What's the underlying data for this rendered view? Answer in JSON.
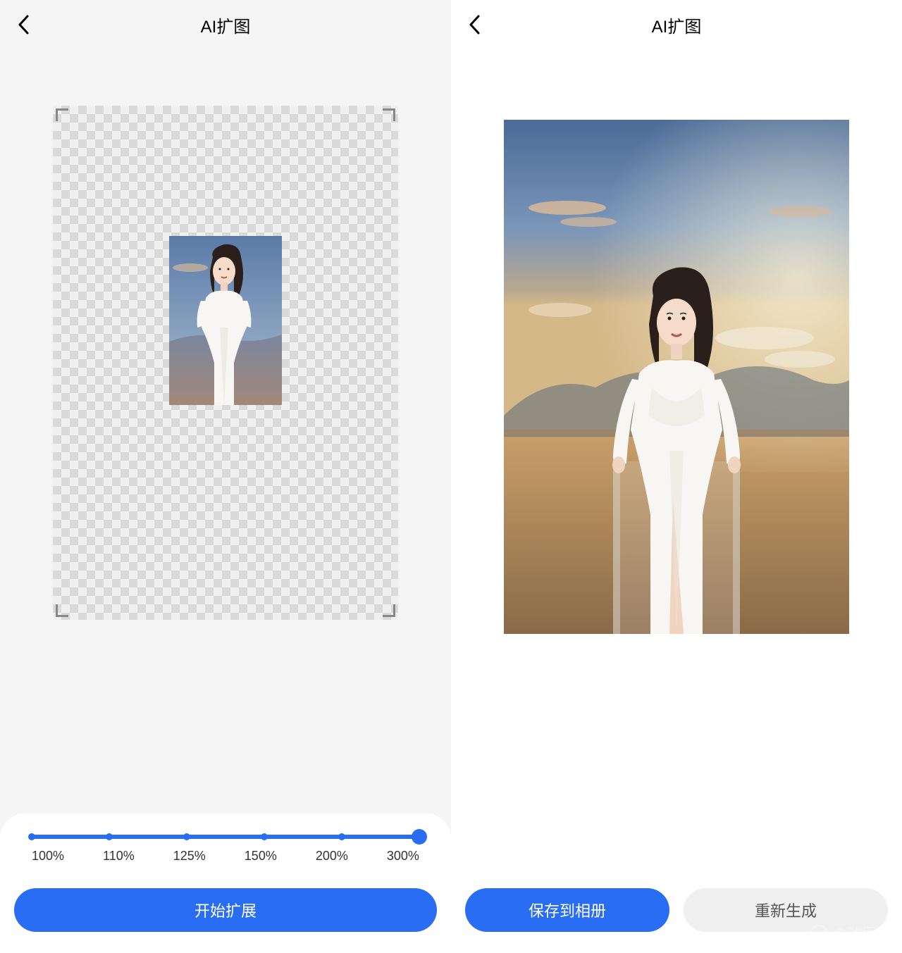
{
  "left": {
    "title": "AI扩图",
    "slider": {
      "labels": [
        "100%",
        "110%",
        "125%",
        "150%",
        "200%",
        "300%"
      ],
      "positions": [
        0,
        20,
        40,
        60,
        80,
        100
      ],
      "selected_index": 5
    },
    "primary_button_label": "开始扩展"
  },
  "right": {
    "title": "AI扩图",
    "save_button_label": "保存到相册",
    "regen_button_label": "重新生成",
    "watermark_text": "@改图鸭"
  }
}
